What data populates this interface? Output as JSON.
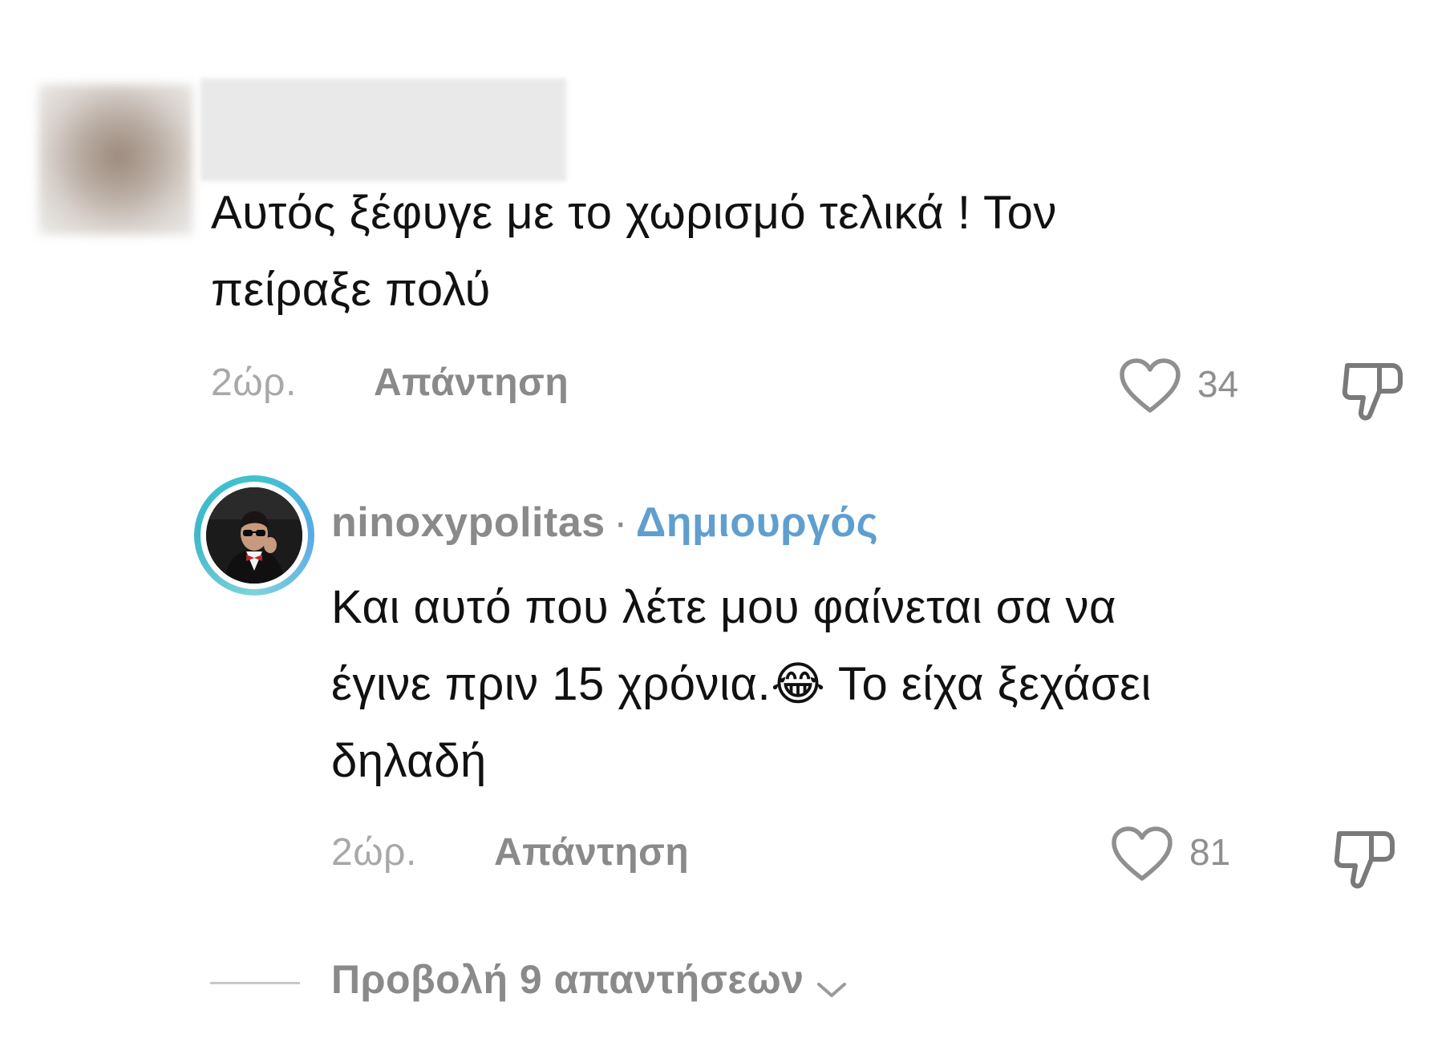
{
  "comment": {
    "text_lines": [
      "Αυτός ξέφυγε με το χωρισμό τελικά ! Τον",
      "πείραξε πολύ"
    ],
    "time": "2ώρ.",
    "reply_label": "Απάντηση",
    "likes": "34"
  },
  "creator_reply": {
    "username": "ninoxypolitas",
    "separator": "·",
    "badge": "Δημιουργός",
    "line1": "Και αυτό που λέτε μου φαίνεται σα να",
    "line2_before_emoji": "έγινε πριν 15 χρόνια.",
    "emoji": "😂",
    "line2_after_emoji": " Το είχα ξεχάσει",
    "line3": "δηλαδή",
    "time": "2ώρ.",
    "reply_label": "Απάντηση",
    "likes": "81"
  },
  "view_replies": {
    "label": "Προβολή 9 απαντήσεων"
  },
  "icons": {
    "like": "heart-outline-icon",
    "dislike": "thumbs-down-outline-icon",
    "expand": "chevron-down-icon"
  },
  "colors": {
    "creator_badge": "#5f9fcf",
    "avatar_ring": "#3fc3cf",
    "secondary_text": "#8a8a8a"
  }
}
